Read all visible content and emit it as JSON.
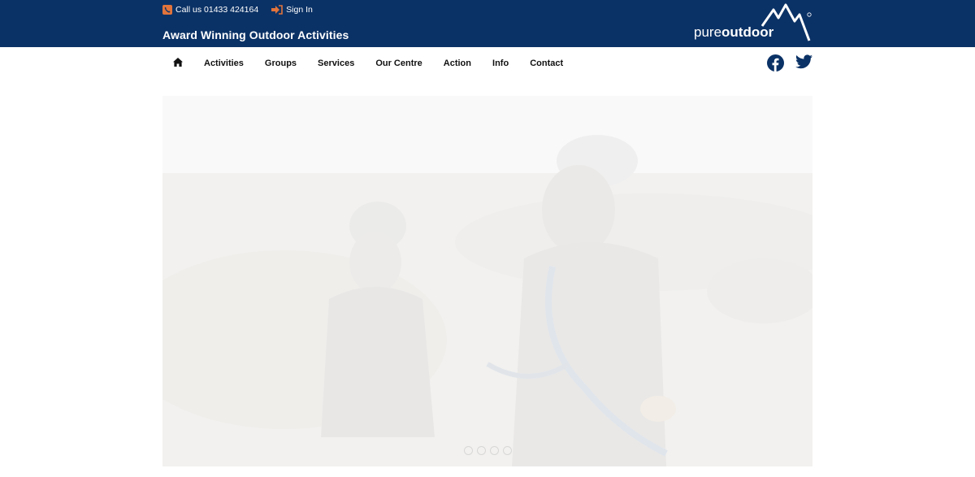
{
  "header": {
    "call_label": "Call us 01433 424164",
    "signin_label": "Sign In",
    "tagline": "Award Winning Outdoor Activities",
    "logo": {
      "light": "pure",
      "bold": "outdoor"
    }
  },
  "nav": {
    "home_icon": "home-icon",
    "items": [
      {
        "label": "Activities"
      },
      {
        "label": "Groups"
      },
      {
        "label": "Services"
      },
      {
        "label": "Our Centre"
      },
      {
        "label": "Action"
      },
      {
        "label": "Info"
      },
      {
        "label": "Contact"
      }
    ]
  },
  "social": {
    "facebook": "facebook-icon",
    "twitter": "twitter-icon"
  },
  "hero": {
    "slide_count": 4,
    "active_slide": 1
  },
  "colors": {
    "brand_navy": "#0b3266",
    "accent_orange": "#e2743b",
    "hero_background": "#f6f6f5"
  }
}
